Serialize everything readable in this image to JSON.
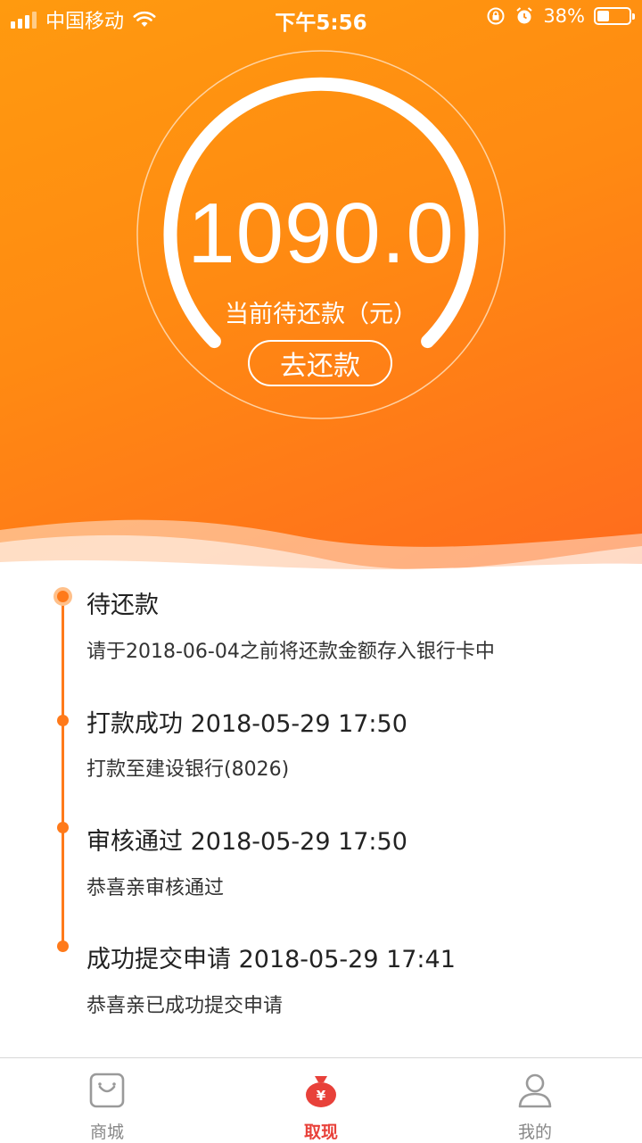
{
  "status_bar": {
    "carrier": "中国移动",
    "time": "下午5:56",
    "battery": "38%",
    "battery_level": 0.38
  },
  "hero": {
    "amount": "1090.0",
    "amount_label": "当前待还款（元）",
    "repay_button": "去还款"
  },
  "timeline": [
    {
      "title": "待还款",
      "subtitle": "请于2018-06-04之前将还款金额存入银行卡中",
      "active": true
    },
    {
      "title": "打款成功 2018-05-29 17:50",
      "subtitle": "打款至建设银行(8026)",
      "active": false
    },
    {
      "title": "审核通过 2018-05-29 17:50",
      "subtitle": "恭喜亲审核通过",
      "active": false
    },
    {
      "title": "成功提交申请 2018-05-29 17:41",
      "subtitle": "恭喜亲已成功提交申请",
      "active": false
    }
  ],
  "tabbar": [
    {
      "label": "商城",
      "icon": "shop-bag-icon",
      "active": false
    },
    {
      "label": "取现",
      "icon": "money-bag-icon",
      "active": true
    },
    {
      "label": "我的",
      "icon": "person-icon",
      "active": false
    }
  ],
  "colors": {
    "accent": "#ff7a1a",
    "tab_active": "#e8413a",
    "tab_inactive": "#888888"
  }
}
